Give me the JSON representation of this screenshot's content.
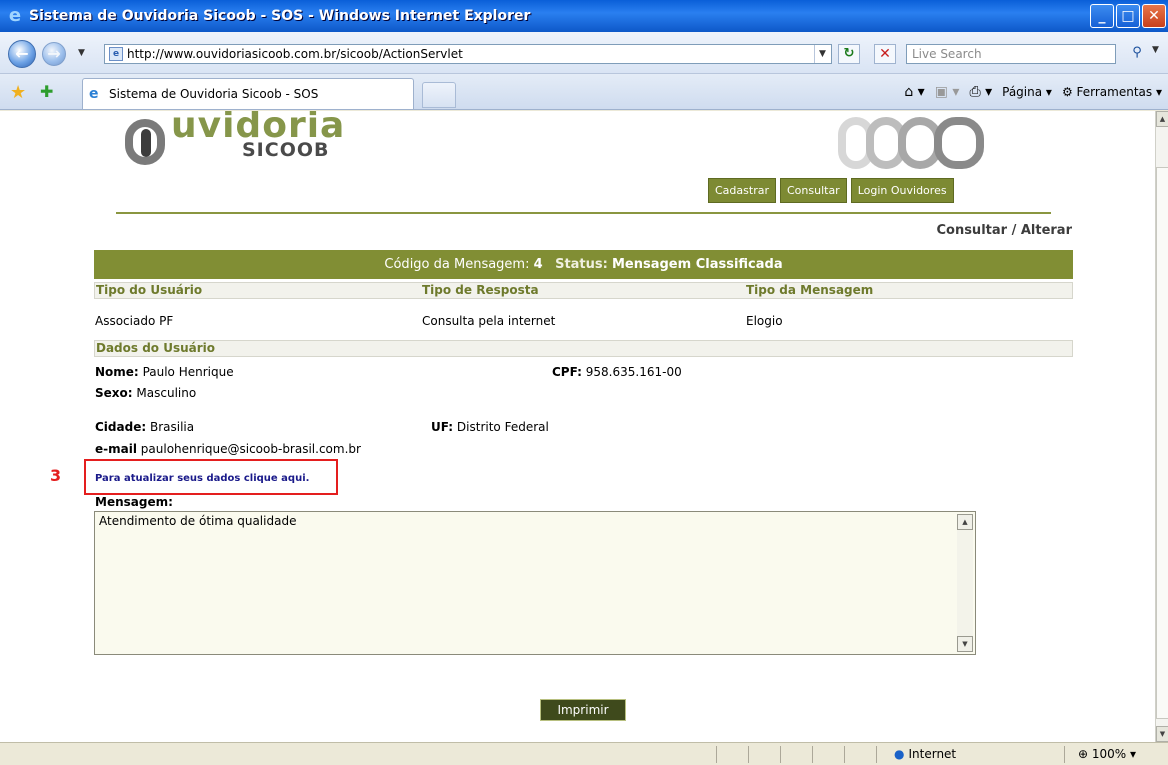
{
  "window": {
    "title": "Sistema de Ouvidoria Sicoob - SOS - Windows Internet Explorer"
  },
  "address_bar": {
    "url": "http://www.ouvidoriasicoob.com.br/sicoob/ActionServlet",
    "search_placeholder": "Live Search"
  },
  "tab_bar": {
    "active_tab": "Sistema de Ouvidoria Sicoob - SOS",
    "tools": {
      "page": "Página",
      "tools": "Ferramentas"
    }
  },
  "page": {
    "logo": {
      "word1": "uvidoria",
      "word2": "SICOOB"
    },
    "menu": [
      "Cadastrar",
      "Consultar",
      "Login Ouvidores"
    ],
    "title": "Consultar / Alterar",
    "header": {
      "code_label": "Código da Mensagem:",
      "code_value": "4",
      "status_label": "Status:",
      "status_value": "Mensagem Classificada"
    },
    "columns": [
      "Tipo do Usuário",
      "Tipo de Resposta",
      "Tipo da Mensagem"
    ],
    "values": [
      "Associado PF",
      "Consulta pela internet",
      "Elogio"
    ],
    "user_section": "Dados do Usuário",
    "user": {
      "name_label": "Nome:",
      "name_value": "Paulo Henrique",
      "cpf_label": "CPF:",
      "cpf_value": "958.635.161-00",
      "sex_label": "Sexo:",
      "sex_value": "Masculino",
      "city_label": "Cidade:",
      "city_value": "Brasilia",
      "uf_label": "UF:",
      "uf_value": "Distrito Federal",
      "email_label": "e-mail",
      "email_value": "paulohenrique@sicoob-brasil.com.br"
    },
    "update_link": "Para atualizar seus dados clique aqui.",
    "annotation_number": "3",
    "message_label": "Mensagem:",
    "message_text": "Atendimento de ótima qualidade",
    "print_button": "Imprimir"
  },
  "status_bar": {
    "zone": "Internet",
    "zoom": "100%"
  }
}
